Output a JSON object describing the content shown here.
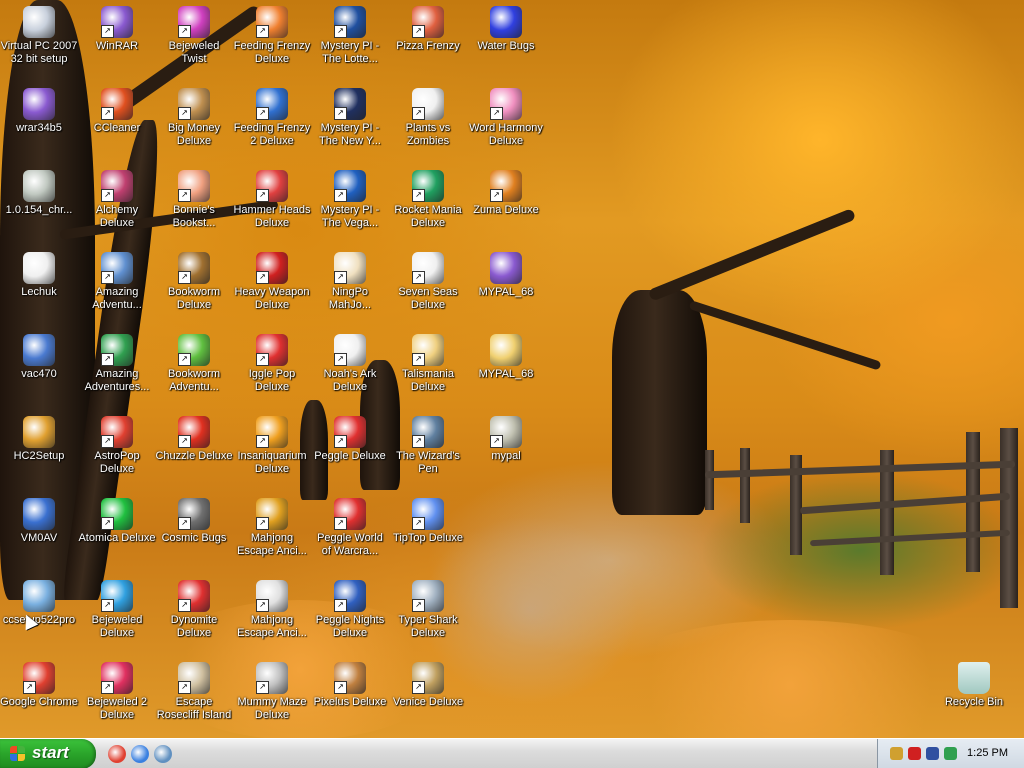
{
  "desktop": {
    "icons": [
      {
        "label": "Virtual PC 2007 32 bit setup",
        "icon": "disc-icon",
        "color": "#c8d0dc",
        "shortcut": false
      },
      {
        "label": "wrar34b5",
        "icon": "winrar-icon",
        "color": "#8a5ad0",
        "shortcut": false
      },
      {
        "label": "1.0.154_chr...",
        "icon": "cd-installer-icon",
        "color": "#c0c8c0",
        "shortcut": false
      },
      {
        "label": "Lechuk",
        "icon": "document-icon",
        "color": "#f0f0f0",
        "shortcut": false
      },
      {
        "label": "vac470",
        "icon": "archive-icon",
        "color": "#4a7ad0",
        "shortcut": false
      },
      {
        "label": "HC2Setup",
        "icon": "setup-box-icon",
        "color": "#e0a030",
        "shortcut": false
      },
      {
        "label": "VM0AV",
        "icon": "shield-icon",
        "color": "#3a70d0",
        "shortcut": false
      },
      {
        "label": "ccsetup522pro",
        "icon": "setup-icon",
        "color": "#7ab0e0",
        "shortcut": false
      },
      {
        "label": "Google Chrome",
        "icon": "chrome-icon",
        "color": "#e04030",
        "shortcut": true
      },
      {
        "label": "WinRAR",
        "icon": "winrar-icon",
        "color": "#8a5ad0",
        "shortcut": true
      },
      {
        "label": "CCleaner",
        "icon": "ccleaner-icon",
        "color": "#e05020",
        "shortcut": true
      },
      {
        "label": "Alchemy Deluxe",
        "icon": "alchemy-icon",
        "color": "#c04070",
        "shortcut": true
      },
      {
        "label": "Amazing Adventu...",
        "icon": "diamond-icon",
        "color": "#6090d0",
        "shortcut": true
      },
      {
        "label": "Amazing Adventures...",
        "icon": "compass-icon",
        "color": "#30a050",
        "shortcut": true
      },
      {
        "label": "AstroPop Deluxe",
        "icon": "astropop-icon",
        "color": "#e04030",
        "shortcut": true
      },
      {
        "label": "Atomica Deluxe",
        "icon": "atom-icon",
        "color": "#20c040",
        "shortcut": true
      },
      {
        "label": "Bejeweled Deluxe",
        "icon": "gem-icon",
        "color": "#30a0e0",
        "shortcut": true
      },
      {
        "label": "Bejeweled 2 Deluxe",
        "icon": "gem-icon",
        "color": "#e03060",
        "shortcut": true
      },
      {
        "label": "Bejeweled Twist",
        "icon": "gem-icon",
        "color": "#d040c0",
        "shortcut": true
      },
      {
        "label": "Big Money Deluxe",
        "icon": "moneybag-icon",
        "color": "#c09050",
        "shortcut": true
      },
      {
        "label": "Bonnie's Bookst...",
        "icon": "bonnie-icon",
        "color": "#f0a080",
        "shortcut": true
      },
      {
        "label": "Bookworm Deluxe",
        "icon": "book-icon",
        "color": "#a07030",
        "shortcut": true
      },
      {
        "label": "Bookworm Adventu...",
        "icon": "worm-icon",
        "color": "#60c040",
        "shortcut": true
      },
      {
        "label": "Chuzzle Deluxe",
        "icon": "chuzzle-icon",
        "color": "#e03020",
        "shortcut": true
      },
      {
        "label": "Cosmic Bugs",
        "icon": "bug-icon",
        "color": "#707070",
        "shortcut": true
      },
      {
        "label": "Dynomite Deluxe",
        "icon": "egg-icon",
        "color": "#e03030",
        "shortcut": true
      },
      {
        "label": "Escape Rosecliff Island",
        "icon": "escape-icon",
        "color": "#d0c0a0",
        "shortcut": true
      },
      {
        "label": "Feeding Frenzy Deluxe",
        "icon": "fish-icon",
        "color": "#f08030",
        "shortcut": true
      },
      {
        "label": "Feeding Frenzy 2 Deluxe",
        "icon": "fish-icon",
        "color": "#3070d0",
        "shortcut": true
      },
      {
        "label": "Hammer Heads Deluxe",
        "icon": "gnome-icon",
        "color": "#e04040",
        "shortcut": true
      },
      {
        "label": "Heavy Weapon Deluxe",
        "icon": "radiation-icon",
        "color": "#d02020",
        "shortcut": true
      },
      {
        "label": "Iggle Pop Deluxe",
        "icon": "iggle-icon",
        "color": "#e03030",
        "shortcut": true
      },
      {
        "label": "Insaniquarium Deluxe",
        "icon": "fish-icon",
        "color": "#f0a020",
        "shortcut": true
      },
      {
        "label": "Mahjong Escape Anci...",
        "icon": "mahjong-icon",
        "color": "#e0a020",
        "shortcut": true
      },
      {
        "label": "Mahjong Escape Anci...",
        "icon": "torii-icon",
        "color": "#e0e0e0",
        "shortcut": true
      },
      {
        "label": "Mummy Maze Deluxe",
        "icon": "mummy-icon",
        "color": "#c0c0c0",
        "shortcut": true
      },
      {
        "label": "Mystery PI - The Lotte...",
        "icon": "mystery-pi-icon",
        "color": "#2050a0",
        "shortcut": true
      },
      {
        "label": "Mystery PI - The New Y...",
        "icon": "mystery-pi-icon",
        "color": "#203060",
        "shortcut": true
      },
      {
        "label": "Mystery PI - The Vega...",
        "icon": "mystery-pi-icon",
        "color": "#2060c0",
        "shortcut": true
      },
      {
        "label": "NingPo MahJo...",
        "icon": "mahjong-tile-icon",
        "color": "#f0e0c0",
        "shortcut": true
      },
      {
        "label": "Noah's Ark Deluxe",
        "icon": "dove-icon",
        "color": "#f0f0f0",
        "shortcut": true
      },
      {
        "label": "Peggle Deluxe",
        "icon": "peggle-icon",
        "color": "#e03030",
        "shortcut": true
      },
      {
        "label": "Peggle World of Warcra...",
        "icon": "peggle-icon",
        "color": "#e03030",
        "shortcut": true
      },
      {
        "label": "Peggle Nights Deluxe",
        "icon": "peggle-nights-icon",
        "color": "#3060c0",
        "shortcut": true
      },
      {
        "label": "Pixelus Deluxe",
        "icon": "pixelus-icon",
        "color": "#c08040",
        "shortcut": true
      },
      {
        "label": "Pizza Frenzy",
        "icon": "pizza-icon",
        "color": "#e06040",
        "shortcut": true
      },
      {
        "label": "Plants vs Zombies",
        "icon": "flower-icon",
        "color": "#f0f0f0",
        "shortcut": true
      },
      {
        "label": "Rocket Mania Deluxe",
        "icon": "rocket-icon",
        "color": "#20a060",
        "shortcut": true
      },
      {
        "label": "Seven Seas Deluxe",
        "icon": "skull-icon",
        "color": "#f0f0f0",
        "shortcut": true
      },
      {
        "label": "Talismania Deluxe",
        "icon": "talisman-icon",
        "color": "#f0d080",
        "shortcut": true
      },
      {
        "label": "The Wizard's Pen",
        "icon": "wizard-icon",
        "color": "#6080a0",
        "shortcut": true
      },
      {
        "label": "TipTop Deluxe",
        "icon": "cocktail-icon",
        "color": "#6090f0",
        "shortcut": true
      },
      {
        "label": "Typer Shark Deluxe",
        "icon": "shark-icon",
        "color": "#a0b0c0",
        "shortcut": true
      },
      {
        "label": "Venice Deluxe",
        "icon": "venice-icon",
        "color": "#c0a060",
        "shortcut": true
      },
      {
        "label": "Water Bugs",
        "icon": "water-bug-icon",
        "color": "#3040e0",
        "shortcut": false
      },
      {
        "label": "Word Harmony Deluxe",
        "icon": "flower-icon",
        "color": "#f090c0",
        "shortcut": true
      },
      {
        "label": "Zuma Deluxe",
        "icon": "zuma-icon",
        "color": "#e08020",
        "shortcut": true
      },
      {
        "label": "MYPAL_68",
        "icon": "winrar-icon",
        "color": "#8a5ad0",
        "shortcut": false
      },
      {
        "label": "MYPAL_68",
        "icon": "folder-icon",
        "color": "#f0d070",
        "shortcut": false
      },
      {
        "label": "mypal",
        "icon": "mypal-icon",
        "color": "#c0c0b0",
        "shortcut": true
      },
      {
        "label": "Recycle Bin",
        "icon": "recycle-bin-icon",
        "color": "#a0c8c0",
        "shortcut": false
      }
    ]
  },
  "taskbar": {
    "start_label": "start",
    "quick_launch": [
      {
        "name": "chrome-quicklaunch",
        "icon": "chrome-icon",
        "color": "#e04030"
      },
      {
        "name": "ie-quicklaunch",
        "icon": "internet-explorer-icon",
        "color": "#3a80e0"
      },
      {
        "name": "show-desktop-quicklaunch",
        "icon": "show-desktop-icon",
        "color": "#6090c0"
      }
    ],
    "tray_icons": [
      {
        "name": "tray-network",
        "icon": "network-icon",
        "color": "#d0a030"
      },
      {
        "name": "tray-security",
        "icon": "security-alert-icon",
        "color": "#d02020"
      },
      {
        "name": "tray-antivirus",
        "icon": "shield-icon",
        "color": "#3050a0"
      },
      {
        "name": "tray-sync",
        "icon": "sync-icon",
        "color": "#30a050"
      }
    ],
    "clock": "1:25 PM"
  }
}
